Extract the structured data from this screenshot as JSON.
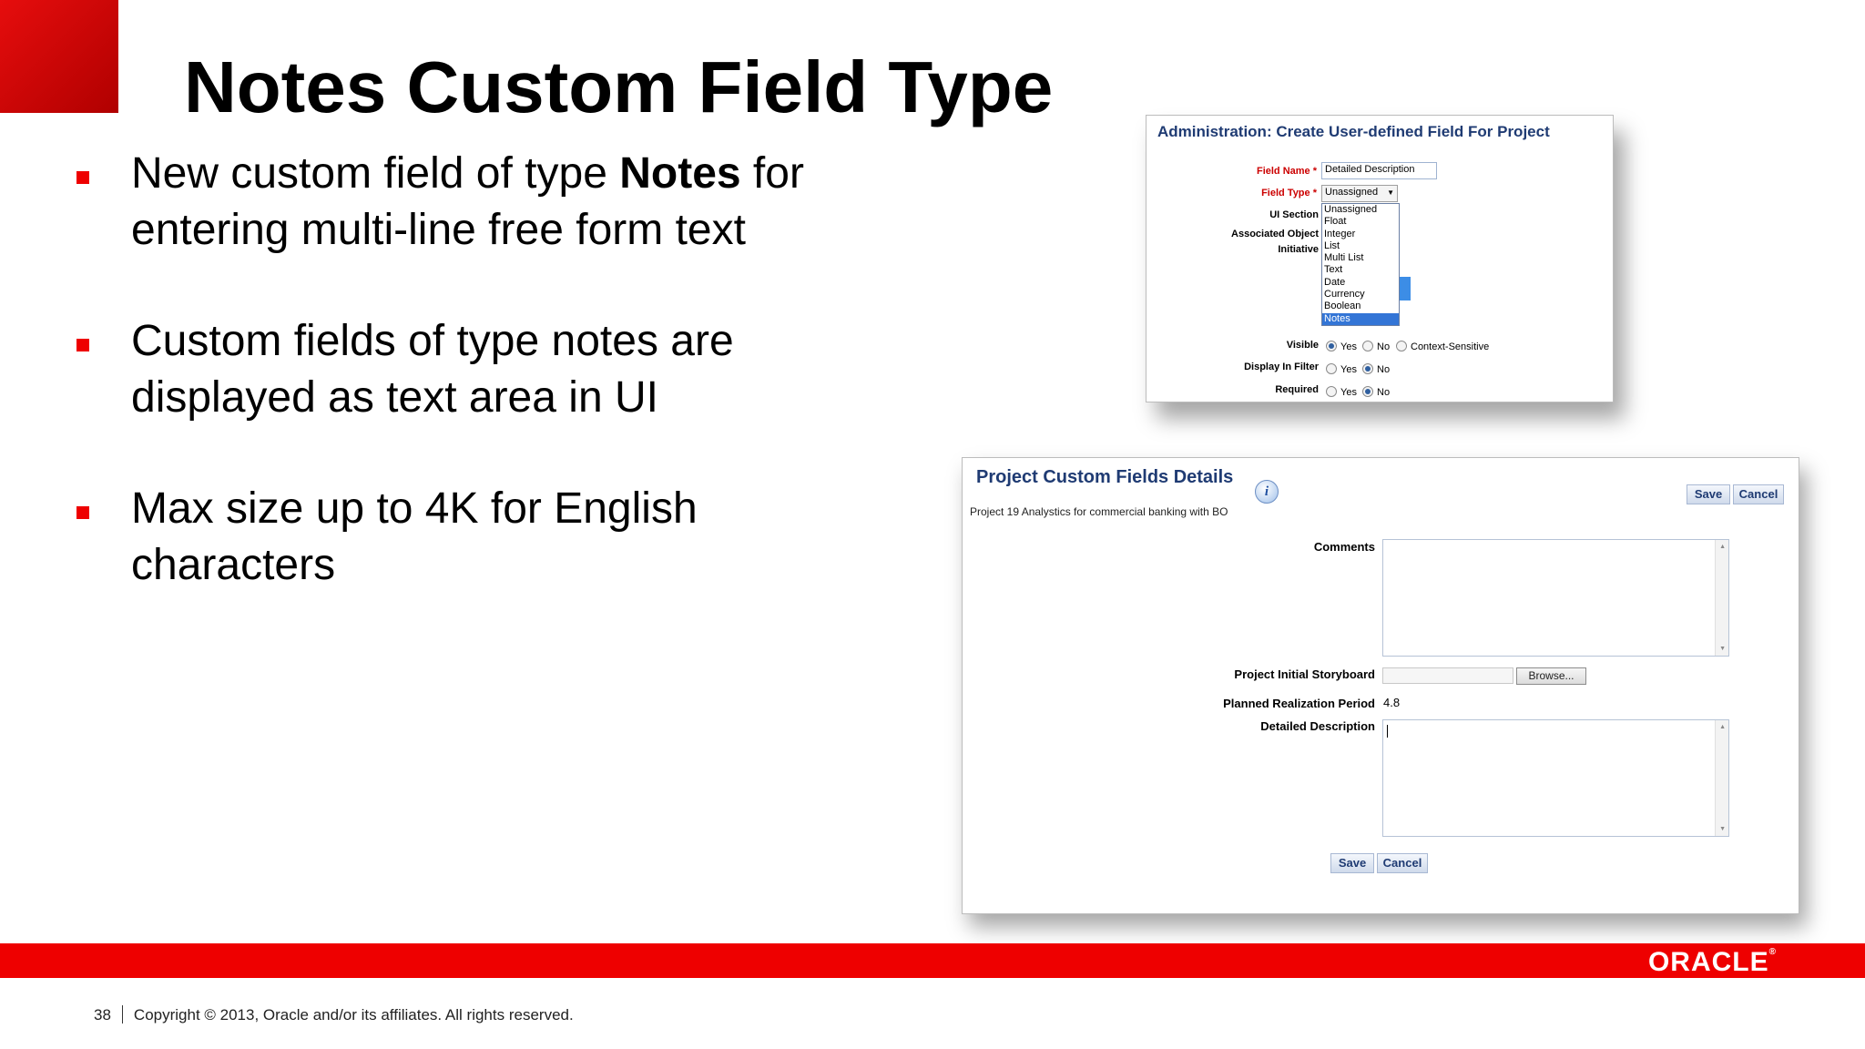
{
  "slide": {
    "title": "Notes Custom Field Type",
    "bullets": [
      {
        "pre": "New custom field of type ",
        "bold": "Notes",
        "post": " for entering multi-line free form text"
      },
      {
        "text": "Custom fields of type notes are displayed as text area in UI"
      },
      {
        "text": "Max size up to 4K for English characters"
      }
    ]
  },
  "admin_dialog": {
    "title": "Administration: Create User-defined Field For Project",
    "field_name_label": "Field Name",
    "field_name_value": "Detailed Description",
    "field_type_label": "Field Type",
    "field_type_value": "Unassigned",
    "required_mark": "*",
    "ui_section_label": "UI Section",
    "associated_object_label": "Associated Object",
    "initiative_label": "Initiative",
    "field_type_options": [
      "Unassigned",
      "Float",
      "Integer",
      "List",
      "Multi List",
      "Text",
      "Date",
      "Currency",
      "Boolean",
      "Notes"
    ],
    "selected_option": "Notes",
    "visible_label": "Visible",
    "display_in_filter_label": "Display In Filter",
    "required_label": "Required",
    "yes": "Yes",
    "no": "No",
    "context_sensitive": "Context-Sensitive"
  },
  "project_dialog": {
    "title": "Project Custom Fields Details",
    "info_icon": "i",
    "subtitle": "Project 19 Analystics for commercial banking with BO",
    "save": "Save",
    "cancel": "Cancel",
    "comments_label": "Comments",
    "storyboard_label": "Project Initial Storyboard",
    "browse": "Browse...",
    "planned_label": "Planned Realization Period",
    "planned_value": "4.8",
    "detailed_label": "Detailed Description"
  },
  "footer": {
    "page": "38",
    "copyright": "Copyright © 2013, Oracle and/or its affiliates. All rights reserved.",
    "logo": "ORACLE",
    "logo_mark": "®"
  },
  "colors": {
    "accent_red": "#ee0000",
    "dialog_title_blue": "#1f3b73",
    "selection_blue": "#3375d6"
  }
}
